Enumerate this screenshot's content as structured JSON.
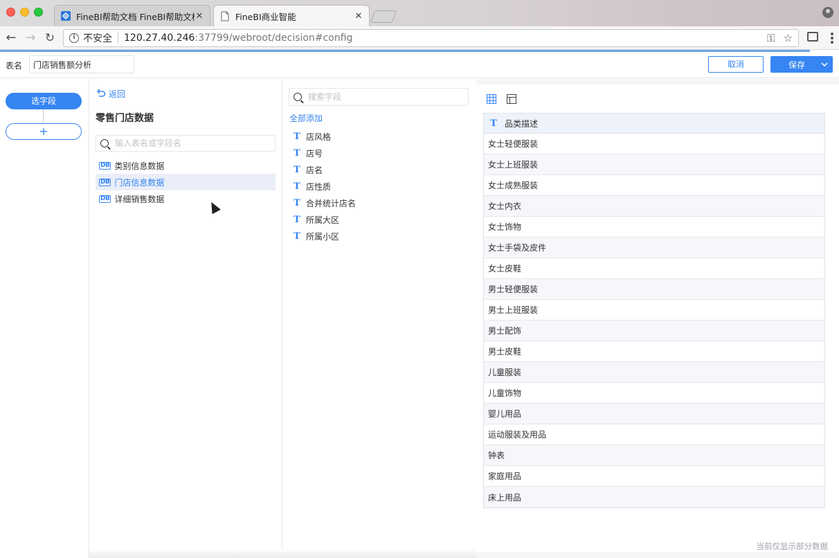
{
  "browser": {
    "tabs": [
      {
        "title": "FineBI帮助文档 FineBI帮助文档",
        "active": false
      },
      {
        "title": "FineBI商业智能",
        "active": true
      }
    ],
    "security_label": "不安全",
    "url_host": "120.27.40.246",
    "url_rest": ":37799/webroot/decision#config"
  },
  "header": {
    "table_label": "表名",
    "table_name": "门店销售额分析",
    "cancel_label": "取消",
    "save_label": "保存"
  },
  "steps": {
    "current_label": "选字段",
    "add_label": "+"
  },
  "tables_panel": {
    "back_label": "返回",
    "package_title": "零售门店数据",
    "search_placeholder": "输入表名或字段名",
    "items": [
      {
        "label": "类别信息数据",
        "selected": false
      },
      {
        "label": "门店信息数据",
        "selected": true
      },
      {
        "label": "详细销售数据",
        "selected": false
      }
    ],
    "db_icon_text": "DB"
  },
  "fields_panel": {
    "search_placeholder": "搜索字段",
    "add_all_label": "全部添加",
    "field_type_glyph": "T",
    "fields": [
      "店风格",
      "店号",
      "店名",
      "店性质",
      "合并统计店名",
      "所属大区",
      "所属小区"
    ]
  },
  "preview": {
    "column_header": "品类描述",
    "rows": [
      "女士轻便服装",
      "女士上班服装",
      "女士成熟服装",
      "女士内衣",
      "女士饰物",
      "女士手袋及皮件",
      "女士皮鞋",
      "男士轻便服装",
      "男士上班服装",
      "男士配饰",
      "男士皮鞋",
      "儿童服装",
      "儿童饰物",
      "婴儿用品",
      "运动服装及用品",
      "钟表",
      "家庭用品",
      "床上用品"
    ],
    "footer_note": "当前仅显示部分数据"
  },
  "colors": {
    "accent": "#3685f2",
    "selected_row_bg": "#e9eef9",
    "table_header_bg": "#edf2fb"
  }
}
